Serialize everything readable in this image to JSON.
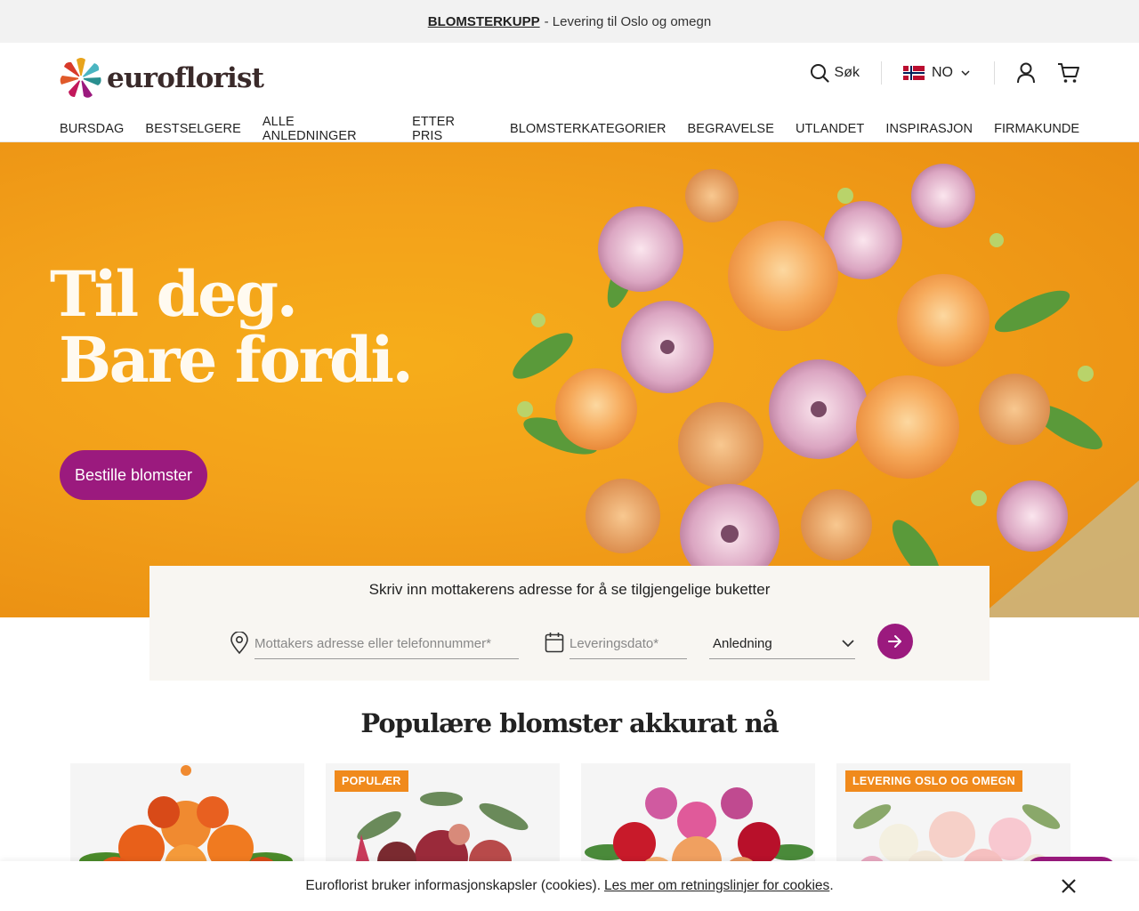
{
  "promo": {
    "link": "BLOMSTERKUPP",
    "text": "- Levering til Oslo og omegn"
  },
  "header": {
    "logo_text": "euroflorist",
    "search_label": "Søk",
    "language": "NO"
  },
  "nav": {
    "items": [
      "BURSDAG",
      "BESTSELGERE",
      "ALLE ANLEDNINGER",
      "ETTER PRIS",
      "BLOMSTERKATEGORIER",
      "BEGRAVELSE",
      "UTLANDET",
      "INSPIRASJON"
    ],
    "right": "FIRMAKUNDE"
  },
  "hero": {
    "title_line1": "Til deg.",
    "title_line2": "Bare fordi.",
    "cta": "Bestille blomster"
  },
  "search": {
    "heading": "Skriv inn mottakerens adresse for å se tilgjengelige buketter",
    "address_placeholder": "Mottakers adresse eller telefonnummer*",
    "date_placeholder": "Leveringsdato*",
    "occasion_value": "Anledning"
  },
  "popular": {
    "title": "Populære blomster akkurat nå",
    "cards": [
      {
        "badge": ""
      },
      {
        "badge": "POPULÆR"
      },
      {
        "badge": ""
      },
      {
        "badge": "LEVERING OSLO OG OMEGN"
      }
    ]
  },
  "cookie": {
    "text": "Euroflorist bruker informasjonskapsler (cookies).",
    "link": "Les mer om retningslinjer for cookies",
    "period": "."
  },
  "colors": {
    "brand_purple": "#9b1a7e",
    "hero_orange": "#f3a11a",
    "badge_orange": "#f08a1c"
  }
}
